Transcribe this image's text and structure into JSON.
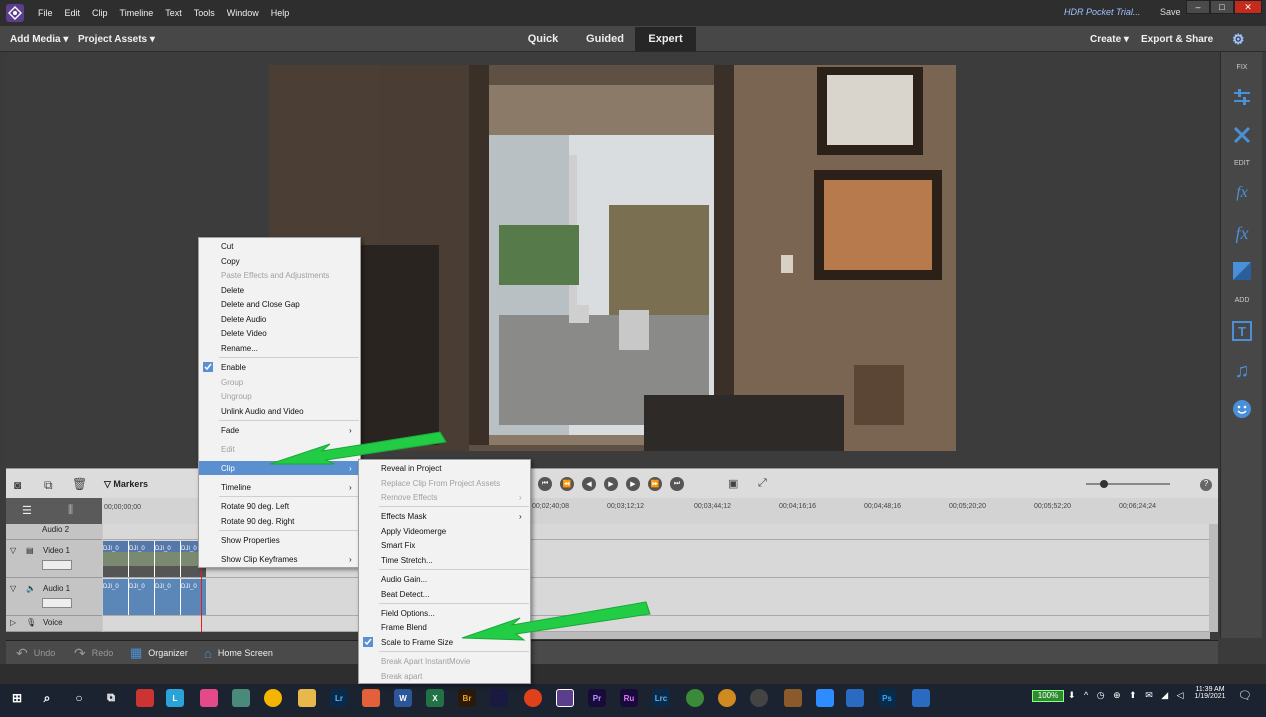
{
  "menubar": {
    "items": [
      "File",
      "Edit",
      "Clip",
      "Timeline",
      "Text",
      "Tools",
      "Window",
      "Help"
    ],
    "trial": "HDR Pocket Trial...",
    "save": "Save"
  },
  "toolbar": {
    "add_media": "Add Media",
    "project_assets": "Project Assets",
    "modes": [
      "Quick",
      "Guided",
      "Expert"
    ],
    "active_mode": "Expert",
    "create": "Create",
    "export_share": "Export & Share"
  },
  "panel": {
    "fix": "FIX",
    "edit": "EDIT",
    "add": "ADD"
  },
  "timeline": {
    "markers": "Markers",
    "timecode": "00;00;00;00",
    "ruler": [
      "00;02;40;08",
      "00;03;12;12",
      "00;03;44;12",
      "00;04;16;16",
      "00;04;48;16",
      "00;05;20;20",
      "00;05;52;20",
      "00;06;24;24"
    ],
    "tracks": {
      "audio2": "Audio 2",
      "video1": "Video 1",
      "audio1": "Audio 1",
      "voice": "Voice"
    },
    "clip_label": "DJI_0"
  },
  "bottombar": {
    "undo": "Undo",
    "redo": "Redo",
    "organizer": "Organizer",
    "home": "Home Screen"
  },
  "context_menu": {
    "items": [
      "Cut",
      "Copy",
      "Paste Effects and Adjustments",
      "Delete",
      "Delete and Close Gap",
      "Delete Audio",
      "Delete Video",
      "Rename...",
      "Enable",
      "Group",
      "Ungroup",
      "Unlink Audio and Video",
      "Fade",
      "Edit",
      "Clip",
      "Timeline",
      "Rotate 90 deg. Left",
      "Rotate 90 deg. Right",
      "Show Properties",
      "Show Clip Keyframes"
    ]
  },
  "clip_submenu": {
    "items": [
      "Reveal in Project",
      "Replace Clip From Project Assets",
      "Remove Effects",
      "Effects Mask",
      "Apply Videomerge",
      "Smart Fix",
      "Time Stretch...",
      "Audio Gain...",
      "Beat Detect...",
      "Field Options...",
      "Frame Blend",
      "Scale to Frame Size",
      "Break Apart InstantMovie",
      "Break apart"
    ]
  },
  "taskbar": {
    "battery": "100%",
    "time": "11:39 AM",
    "date": "1/19/2021",
    "apps": [
      "L",
      "Lr",
      "W",
      "X",
      "Br",
      "Pr",
      "Ru",
      "Lrc",
      "Ps"
    ]
  },
  "colors": {
    "accent": "#5a8fd0",
    "arrow": "#22cc44",
    "panel_icon": "#4a90d9"
  }
}
